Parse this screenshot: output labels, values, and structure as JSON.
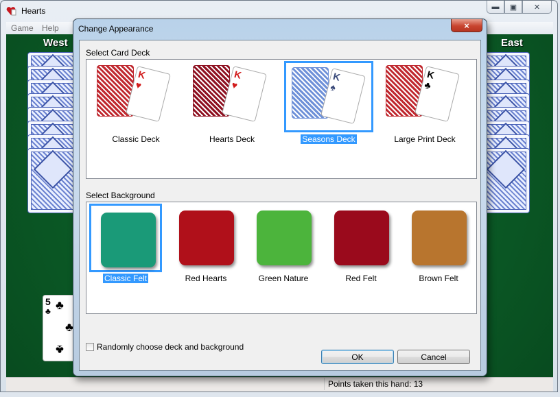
{
  "window": {
    "title": "Hearts",
    "icon": "hearts-app-icon",
    "caption_buttons": {
      "minimize": "minimize-icon",
      "maximize": "maximize-icon",
      "close": "close-icon"
    }
  },
  "menu": {
    "items": [
      "Game",
      "Help"
    ]
  },
  "game": {
    "players": {
      "west": "West",
      "east": "East"
    },
    "face_up_card": {
      "rank": "5",
      "suit": "♣"
    },
    "status": "Points taken this hand: 13"
  },
  "dialog": {
    "title": "Change Appearance",
    "close_icon": "×",
    "deck_section_label": "Select Card Deck",
    "decks": [
      {
        "label": "Classic Deck",
        "selected": false,
        "back_color": "#c0282f",
        "king_suit": "♥",
        "suit_color": "#d11a1a"
      },
      {
        "label": "Hearts Deck",
        "selected": false,
        "back_color": "#8e1020",
        "king_suit": "♥",
        "suit_color": "#d11a1a"
      },
      {
        "label": "Seasons Deck",
        "selected": true,
        "back_color": "#6f91d8",
        "king_suit": "♠",
        "suit_color": "#3a4a7a"
      },
      {
        "label": "Large Print Deck",
        "selected": false,
        "back_color": "#c0282f",
        "king_suit": "♣",
        "suit_color": "#000000"
      }
    ],
    "background_section_label": "Select Background",
    "backgrounds": [
      {
        "label": "Classic Felt",
        "selected": true,
        "color": "#1a9a78"
      },
      {
        "label": "Red Hearts",
        "selected": false,
        "color": "#b0101a"
      },
      {
        "label": "Green Nature",
        "selected": false,
        "color": "#4cb43c"
      },
      {
        "label": "Red Felt",
        "selected": false,
        "color": "#9a0a1c"
      },
      {
        "label": "Brown Felt",
        "selected": false,
        "color": "#b8752e"
      }
    ],
    "random_checkbox": {
      "label": "Randomly choose deck and background",
      "checked": false
    },
    "ok_label": "OK",
    "cancel_label": "Cancel"
  }
}
